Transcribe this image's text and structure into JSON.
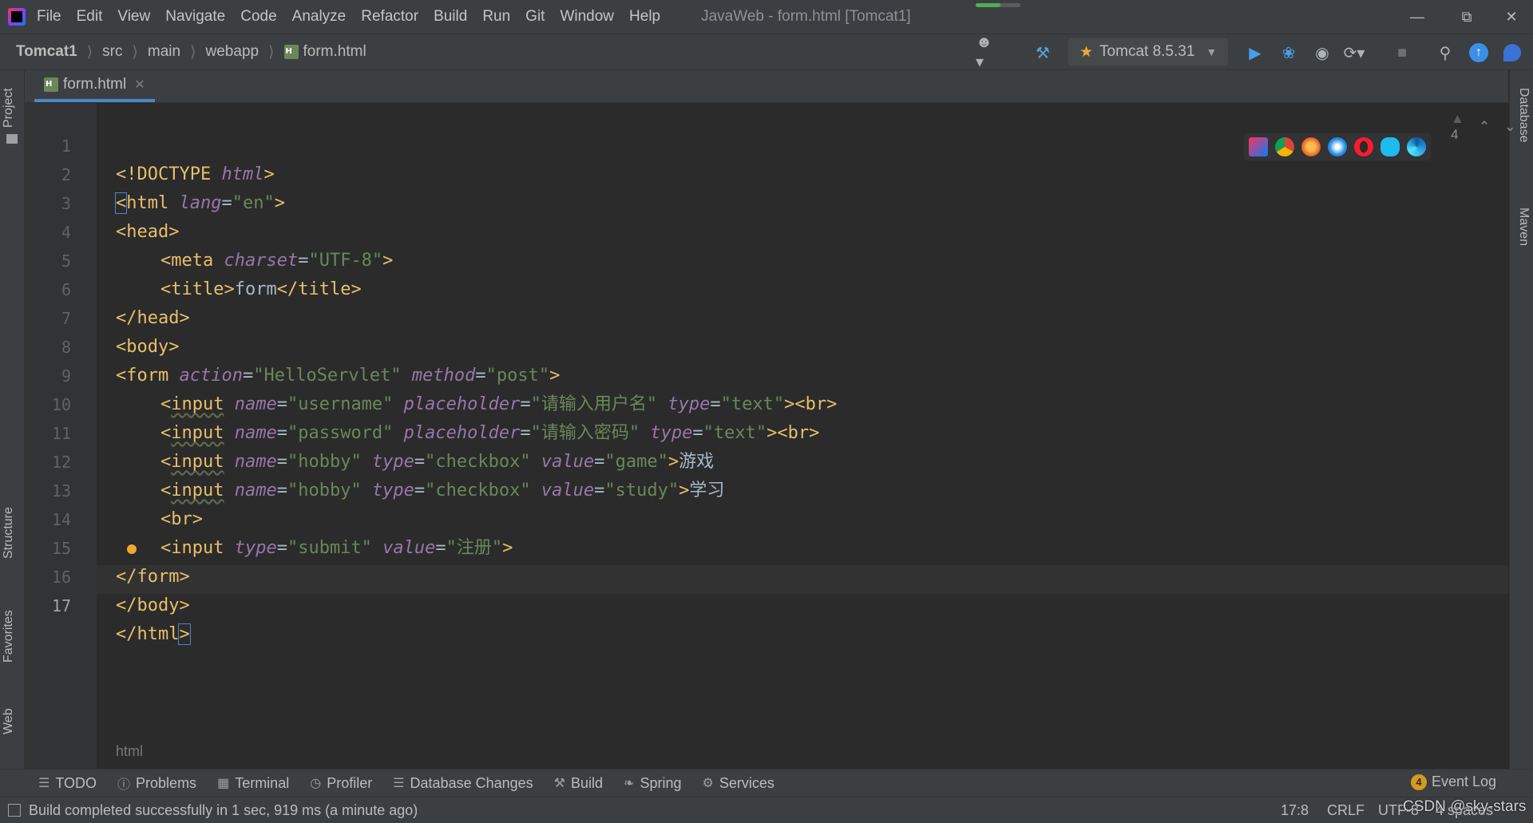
{
  "menu": {
    "items": [
      "File",
      "Edit",
      "View",
      "Navigate",
      "Code",
      "Analyze",
      "Refactor",
      "Build",
      "Run",
      "Git",
      "Window",
      "Help"
    ]
  },
  "window": {
    "title": "JavaWeb - form.html [Tomcat1]",
    "progress": 0.55
  },
  "breadcrumb": {
    "project": "Tomcat1",
    "parts": [
      "src",
      "main",
      "webapp"
    ],
    "file": "form.html"
  },
  "run_config": {
    "label": "Tomcat 8.5.31"
  },
  "side_tabs": {
    "left": [
      "Project",
      "Structure",
      "Favorites",
      "Web"
    ],
    "right": [
      "Database",
      "Maven"
    ]
  },
  "editor": {
    "tab_label": "form.html",
    "inspection_count": "4",
    "bottom_breadcrumb": "html",
    "current_line": 17,
    "lines": [
      {
        "n": "1"
      },
      {
        "n": "2"
      },
      {
        "n": "3"
      },
      {
        "n": "4"
      },
      {
        "n": "5"
      },
      {
        "n": "6"
      },
      {
        "n": "7"
      },
      {
        "n": "8"
      },
      {
        "n": "9"
      },
      {
        "n": "10"
      },
      {
        "n": "11"
      },
      {
        "n": "12"
      },
      {
        "n": "13"
      },
      {
        "n": "14"
      },
      {
        "n": "15"
      },
      {
        "n": "16"
      },
      {
        "n": "17"
      }
    ],
    "code": {
      "l1": [
        "<!DOCTYPE ",
        "html",
        ">"
      ],
      "l2": [
        "<",
        "html",
        " ",
        "lang",
        "=",
        "\"en\"",
        ">"
      ],
      "l3": [
        "<",
        "head",
        ">"
      ],
      "l4": [
        "<",
        "meta",
        " ",
        "charset",
        "=",
        "\"UTF-8\"",
        ">"
      ],
      "l5": [
        "<",
        "title",
        ">",
        "form",
        "</",
        "title",
        ">"
      ],
      "l6": [
        "</",
        "head",
        ">"
      ],
      "l7": [
        "<",
        "body",
        ">"
      ],
      "l8": [
        "<",
        "form",
        " ",
        "action",
        "=",
        "\"HelloServlet\"",
        " ",
        "method",
        "=",
        "\"post\"",
        ">"
      ],
      "l9": [
        "<",
        "input",
        " ",
        "name",
        "=",
        "\"username\"",
        " ",
        "placeholder",
        "=",
        "\"请输入用户名\"",
        " ",
        "type",
        "=",
        "\"text\"",
        "><",
        "br",
        ">"
      ],
      "l10": [
        "<",
        "input",
        " ",
        "name",
        "=",
        "\"password\"",
        " ",
        "placeholder",
        "=",
        "\"请输入密码\"",
        " ",
        "type",
        "=",
        "\"text\"",
        "><",
        "br",
        ">"
      ],
      "l11": [
        "<",
        "input",
        " ",
        "name",
        "=",
        "\"hobby\"",
        " ",
        "type",
        "=",
        "\"checkbox\"",
        " ",
        "value",
        "=",
        "\"game\"",
        ">",
        "游戏"
      ],
      "l12": [
        "<",
        "input",
        " ",
        "name",
        "=",
        "\"hobby\"",
        " ",
        "type",
        "=",
        "\"checkbox\"",
        " ",
        "value",
        "=",
        "\"study\"",
        ">",
        "学习"
      ],
      "l13": [
        "<",
        "br",
        ">"
      ],
      "l14": [
        "<",
        "input",
        " ",
        "type",
        "=",
        "\"submit\"",
        " ",
        "value",
        "=",
        "\"注册\"",
        ">"
      ],
      "l15": [
        "</",
        "form",
        ">"
      ],
      "l16": [
        "<",
        "/body",
        ">"
      ],
      "l17": [
        "</",
        "html",
        ">"
      ]
    }
  },
  "tool_windows": [
    "TODO",
    "Problems",
    "Terminal",
    "Profiler",
    "Database Changes",
    "Build",
    "Spring",
    "Services"
  ],
  "event_log": {
    "label": "Event Log",
    "count": "4"
  },
  "status": {
    "message": "Build completed successfully in 1 sec, 919 ms (a minute ago)",
    "position": "17:8",
    "line_sep": "CRLF",
    "encoding": "UTF-8",
    "indent": "4 spaces"
  },
  "watermark": "CSDN @sky-stars",
  "colors": {
    "accent": "#4a88c7",
    "tag": "#e8bf6a",
    "attr": "#9876aa",
    "string": "#6a8759"
  }
}
